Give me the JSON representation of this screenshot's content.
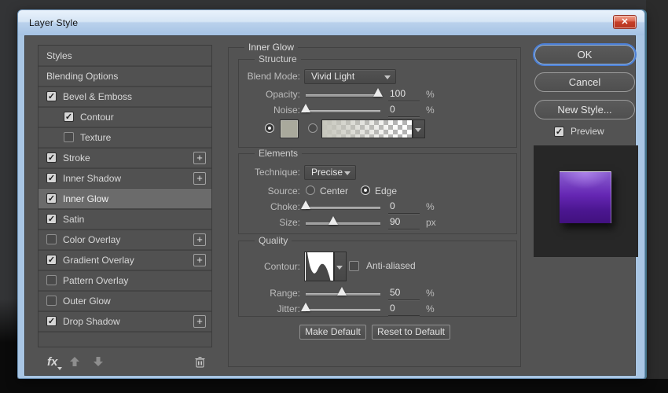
{
  "window": {
    "title": "Layer Style",
    "close": "✕"
  },
  "icons": {
    "check": "✓",
    "plus": "+"
  },
  "sidebar": {
    "items": [
      {
        "label": "Styles",
        "checkbox": false,
        "checked": false,
        "indent": false,
        "plus": false,
        "selected": false
      },
      {
        "label": "Blending Options",
        "checkbox": false,
        "checked": false,
        "indent": false,
        "plus": false,
        "selected": false
      },
      {
        "label": "Bevel & Emboss",
        "checkbox": true,
        "checked": true,
        "indent": false,
        "plus": false,
        "selected": false
      },
      {
        "label": "Contour",
        "checkbox": true,
        "checked": true,
        "indent": true,
        "plus": false,
        "selected": false
      },
      {
        "label": "Texture",
        "checkbox": true,
        "checked": false,
        "indent": true,
        "plus": false,
        "selected": false
      },
      {
        "label": "Stroke",
        "checkbox": true,
        "checked": true,
        "indent": false,
        "plus": true,
        "selected": false
      },
      {
        "label": "Inner Shadow",
        "checkbox": true,
        "checked": true,
        "indent": false,
        "plus": true,
        "selected": false
      },
      {
        "label": "Inner Glow",
        "checkbox": true,
        "checked": true,
        "indent": false,
        "plus": false,
        "selected": true
      },
      {
        "label": "Satin",
        "checkbox": true,
        "checked": true,
        "indent": false,
        "plus": false,
        "selected": false
      },
      {
        "label": "Color Overlay",
        "checkbox": true,
        "checked": false,
        "indent": false,
        "plus": true,
        "selected": false
      },
      {
        "label": "Gradient Overlay",
        "checkbox": true,
        "checked": true,
        "indent": false,
        "plus": true,
        "selected": false
      },
      {
        "label": "Pattern Overlay",
        "checkbox": true,
        "checked": false,
        "indent": false,
        "plus": false,
        "selected": false
      },
      {
        "label": "Outer Glow",
        "checkbox": true,
        "checked": false,
        "indent": false,
        "plus": false,
        "selected": false
      },
      {
        "label": "Drop Shadow",
        "checkbox": true,
        "checked": true,
        "indent": false,
        "plus": true,
        "selected": false
      }
    ],
    "footer": {
      "fx_label": "fx"
    }
  },
  "panel": {
    "title": "Inner Glow",
    "structure": {
      "title": "Structure",
      "blend_mode_label": "Blend Mode:",
      "blend_mode_value": "Vivid Light",
      "opacity_label": "Opacity:",
      "opacity_value": "100",
      "opacity_unit": "%",
      "noise_label": "Noise:",
      "noise_value": "0",
      "noise_unit": "%"
    },
    "elements": {
      "title": "Elements",
      "technique_label": "Technique:",
      "technique_value": "Precise",
      "source_label": "Source:",
      "center_label": "Center",
      "edge_label": "Edge",
      "choke_label": "Choke:",
      "choke_value": "0",
      "choke_unit": "%",
      "size_label": "Size:",
      "size_value": "90",
      "size_unit": "px"
    },
    "quality": {
      "title": "Quality",
      "contour_label": "Contour:",
      "antialiased_label": "Anti-aliased",
      "range_label": "Range:",
      "range_value": "50",
      "range_unit": "%",
      "jitter_label": "Jitter:",
      "jitter_value": "0",
      "jitter_unit": "%"
    },
    "footer_buttons": {
      "make_default": "Make Default",
      "reset_to_default": "Reset to Default"
    }
  },
  "actions": {
    "ok": "OK",
    "cancel": "Cancel",
    "new_style": "New Style...",
    "preview_label": "Preview",
    "preview_checked": true
  },
  "sliders": {
    "opacity": 97,
    "noise": 0,
    "choke": 0,
    "size": 37,
    "range": 48,
    "jitter": 0
  },
  "colors": {
    "dialog_bg": "#535353",
    "frame_blue": "#a9c6e4",
    "titlebar_top": "#e9f2fc",
    "titlebar_bottom": "#a5c3e4",
    "selected_row": "#6b6b6b",
    "focus_ring_blue": "#4b7fd6",
    "close_button_red": "#c63f28",
    "glow_color_swatch": "#a9a99c",
    "preview_bg": "#272727",
    "preview_square_top": "#8a5fd0",
    "preview_square_bottom": "#41117e"
  }
}
